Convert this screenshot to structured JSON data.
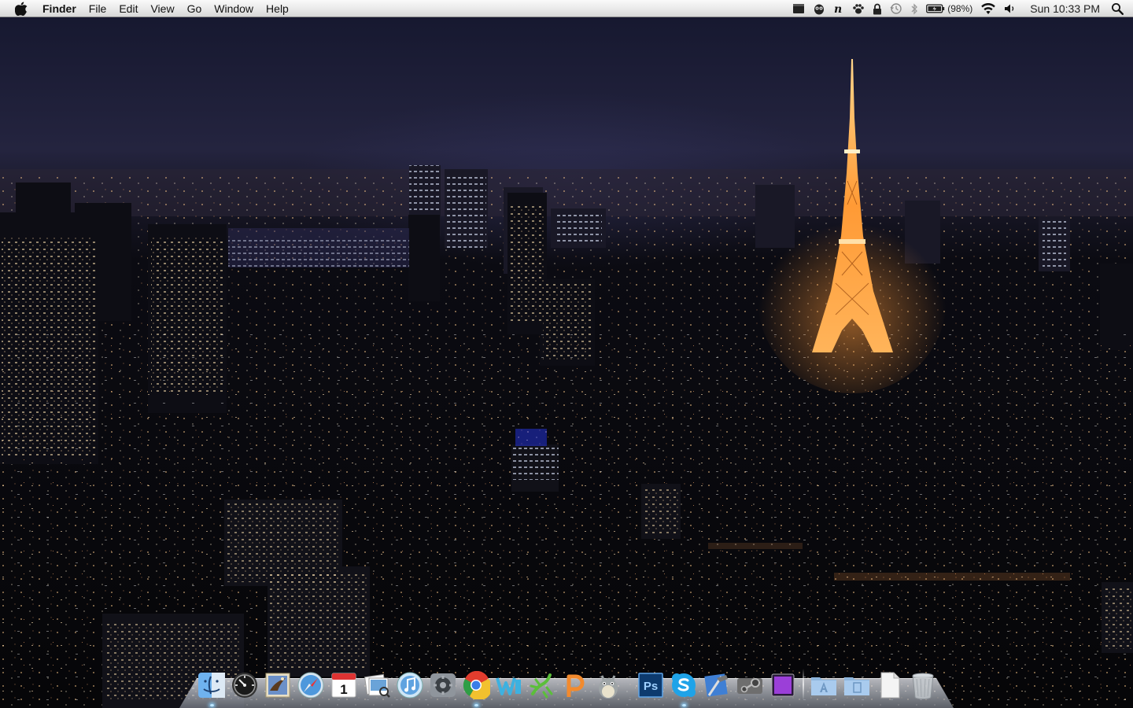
{
  "menubar": {
    "apple_icon": "apple-logo-icon",
    "app_name": "Finder",
    "menus": [
      "File",
      "Edit",
      "View",
      "Go",
      "Window",
      "Help"
    ],
    "status_icons": [
      "menu-extra-icon",
      "owl-icon",
      "notational-n-icon",
      "paw-icon",
      "lock-icon",
      "time-machine-icon",
      "bluetooth-icon",
      "battery-icon",
      "wifi-icon",
      "volume-icon"
    ],
    "battery_percent": "(98%)",
    "clock": "Sun 10:33 PM",
    "spotlight_icon": "spotlight-search-icon"
  },
  "wallpaper": {
    "description_icon": "city-night-wallpaper"
  },
  "dock": {
    "apps": [
      {
        "name": "finder-dock-icon",
        "running": true
      },
      {
        "name": "dashboard-dock-icon",
        "running": false
      },
      {
        "name": "mail-dock-icon",
        "running": false
      },
      {
        "name": "safari-dock-icon",
        "running": false
      },
      {
        "name": "calendar-dock-icon",
        "running": false,
        "day": "1"
      },
      {
        "name": "preview-dock-icon",
        "running": false
      },
      {
        "name": "itunes-dock-icon",
        "running": false
      },
      {
        "name": "system-preferences-dock-icon",
        "running": false
      },
      {
        "name": "chrome-dock-icon",
        "running": true
      },
      {
        "name": "w-app-dock-icon",
        "running": false
      },
      {
        "name": "lizard-app-dock-icon",
        "running": false
      },
      {
        "name": "p-app-dock-icon",
        "running": false
      },
      {
        "name": "totoro-dock-icon",
        "running": false
      },
      {
        "name": "photoshop-dock-icon",
        "running": false,
        "label": "Ps"
      },
      {
        "name": "skype-dock-icon",
        "running": true
      },
      {
        "name": "xcode-dock-icon",
        "running": false
      },
      {
        "name": "steam-dock-icon",
        "running": false
      },
      {
        "name": "purple-app-dock-icon",
        "running": false
      }
    ],
    "stacks": [
      {
        "name": "applications-folder-dock-icon"
      },
      {
        "name": "documents-folder-dock-icon"
      },
      {
        "name": "document-file-dock-icon"
      },
      {
        "name": "trash-dock-icon"
      }
    ]
  },
  "colors": {
    "menubar_top": "#fafafa",
    "menubar_bottom": "#d6d6d6",
    "tower_orange": "#ff8a2a",
    "city_lights": "#ffd7a0"
  }
}
